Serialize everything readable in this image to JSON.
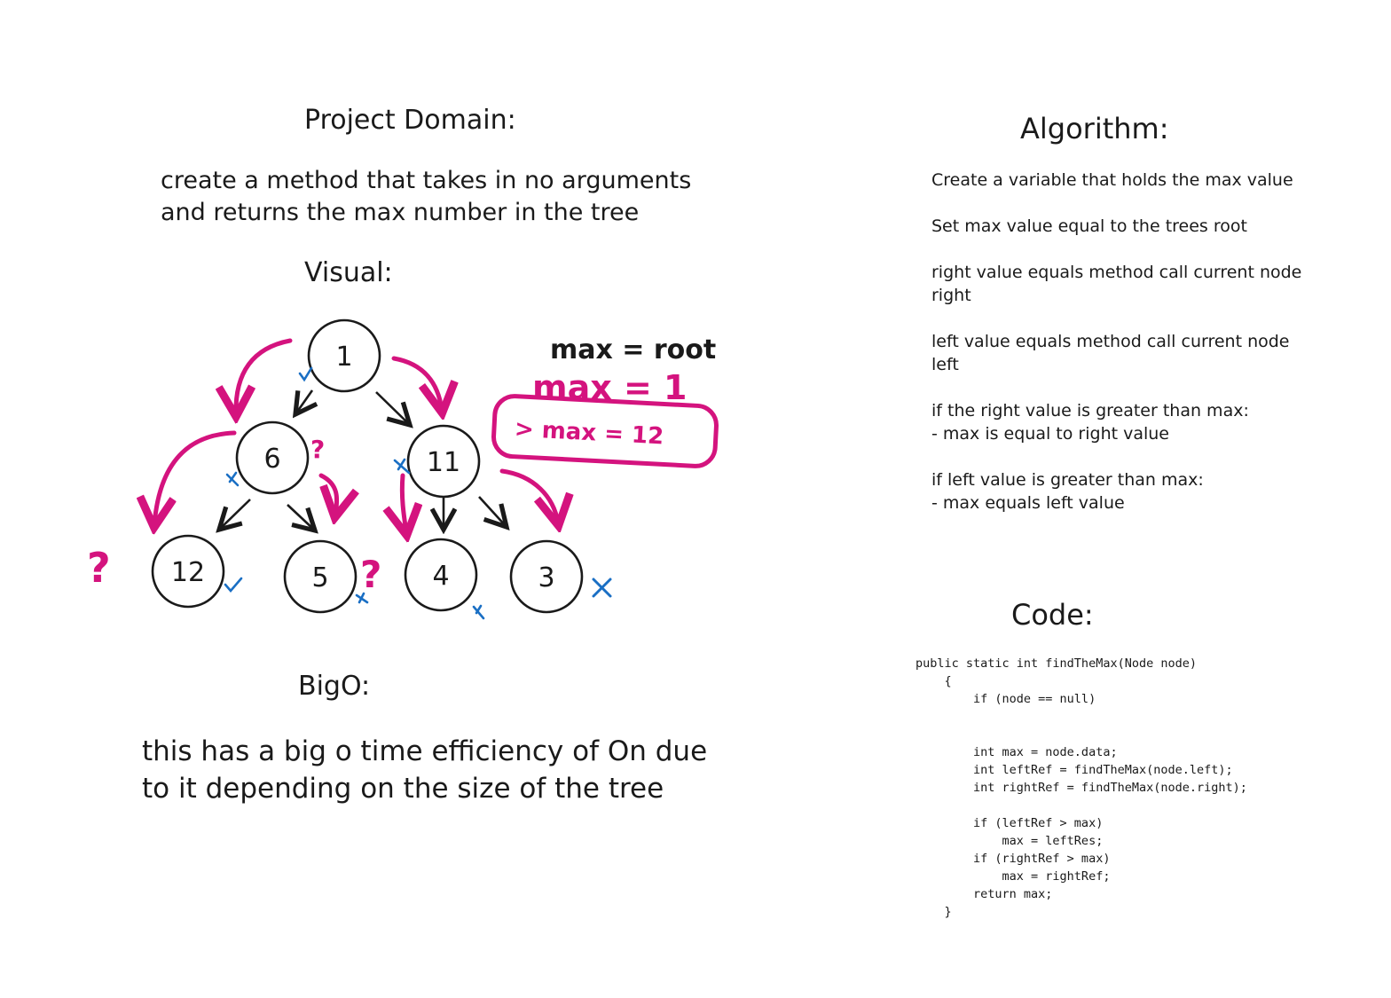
{
  "headings": {
    "domain": "Project Domain:",
    "visual": "Visual:",
    "bigo": "BigO:",
    "algorithm": "Algorithm:",
    "code": "Code:"
  },
  "domain_text": {
    "line1": "create a method that takes in no arguments",
    "line2": "and returns the max number in the tree"
  },
  "bigo_text": {
    "line1": "this has a big o time efficiency of On due",
    "line2": "to it depending on the size of the tree"
  },
  "algorithm_steps": [
    "Create a variable that holds the max value",
    "Set max value equal to the trees root",
    "right value equals method call current node\nright",
    "left value equals method call current node\nleft",
    "if the right value is greater than max:\n- max is equal to right value",
    "if left value is greater than max:\n- max equals left value"
  ],
  "code_text": "public static int findTheMax(Node node)\n    {\n        if (node == null)\n\n\n        int max = node.data;\n        int leftRef = findTheMax(node.left);\n        int rightRef = findTheMax(node.right);\n\n        if (leftRef > max)\n            max = leftRes;\n        if (rightRef > max)\n            max = rightRef;\n        return max;\n    }",
  "tree": {
    "root": "1",
    "level1": [
      "6",
      "11"
    ],
    "level2": [
      "12",
      "5",
      "4",
      "3"
    ]
  },
  "annotations": {
    "max_root": "max = root",
    "max_1": "max = 1",
    "max_12": "> max = 12",
    "question": "?"
  },
  "colors": {
    "ink": "#1a1a1a",
    "pink": "#d4137e",
    "blue": "#1a6fc4"
  }
}
